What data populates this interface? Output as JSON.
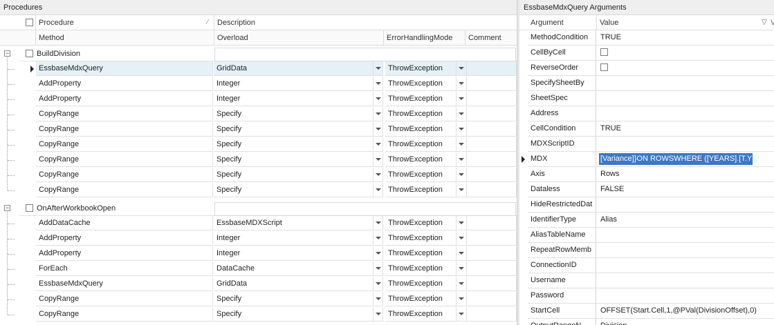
{
  "procedures": {
    "title": "Procedures",
    "header1": {
      "procedure": "Procedure",
      "description": "Description"
    },
    "header2": {
      "method": "Method",
      "overload": "Overload",
      "error_mode": "ErrorHandlingMode",
      "comment": "Comment"
    },
    "groups": [
      {
        "name": "BuildDivision",
        "rows": [
          {
            "method": "EssbaseMdxQuery",
            "overload": "GridData",
            "error_mode": "ThrowException",
            "selected": true
          },
          {
            "method": "AddProperty",
            "overload": "Integer",
            "error_mode": "ThrowException"
          },
          {
            "method": "AddProperty",
            "overload": "Integer",
            "error_mode": "ThrowException"
          },
          {
            "method": "CopyRange",
            "overload": "Specify",
            "error_mode": "ThrowException"
          },
          {
            "method": "CopyRange",
            "overload": "Specify",
            "error_mode": "ThrowException"
          },
          {
            "method": "CopyRange",
            "overload": "Specify",
            "error_mode": "ThrowException"
          },
          {
            "method": "CopyRange",
            "overload": "Specify",
            "error_mode": "ThrowException"
          },
          {
            "method": "CopyRange",
            "overload": "Specify",
            "error_mode": "ThrowException"
          },
          {
            "method": "CopyRange",
            "overload": "Specify",
            "error_mode": "ThrowException"
          }
        ]
      },
      {
        "name": "OnAfterWorkbookOpen",
        "rows": [
          {
            "method": "AddDataCache",
            "overload": "EssbaseMDXScript",
            "error_mode": "ThrowException"
          },
          {
            "method": "AddProperty",
            "overload": "Integer",
            "error_mode": "ThrowException"
          },
          {
            "method": "AddProperty",
            "overload": "Integer",
            "error_mode": "ThrowException"
          },
          {
            "method": "ForEach",
            "overload": "DataCache",
            "error_mode": "ThrowException"
          },
          {
            "method": "EssbaseMdxQuery",
            "overload": "GridData",
            "error_mode": "ThrowException"
          },
          {
            "method": "CopyRange",
            "overload": "Specify",
            "error_mode": "ThrowException"
          },
          {
            "method": "CopyRange",
            "overload": "Specify",
            "error_mode": "ThrowException"
          }
        ]
      }
    ]
  },
  "arguments": {
    "title": "EssbaseMdxQuery Arguments",
    "header": {
      "argument": "Argument",
      "value": "Value",
      "trailing": "V"
    },
    "rows": [
      {
        "name": "MethodCondition",
        "value": "TRUE"
      },
      {
        "name": "CellByCell",
        "value": "",
        "checkbox": true
      },
      {
        "name": "ReverseOrder",
        "value": "",
        "checkbox": true
      },
      {
        "name": "SpecifySheetBy",
        "value": ""
      },
      {
        "name": "SheetSpec",
        "value": ""
      },
      {
        "name": "Address",
        "value": ""
      },
      {
        "name": "CellCondition",
        "value": "TRUE"
      },
      {
        "name": "MDXScriptID",
        "value": ""
      },
      {
        "name": "MDX",
        "value": "[Variance]}ON ROWSWHERE ([YEARS].[T.YEARS])",
        "editing": true,
        "current": true
      },
      {
        "name": "Axis",
        "value": "Rows"
      },
      {
        "name": "Dataless",
        "value": "FALSE"
      },
      {
        "name": "HideRestrictedDat",
        "value": ""
      },
      {
        "name": "IdentifierType",
        "value": "Alias"
      },
      {
        "name": "AliasTableName",
        "value": ""
      },
      {
        "name": "RepeatRowMemb",
        "value": ""
      },
      {
        "name": "ConnectionID",
        "value": ""
      },
      {
        "name": "Username",
        "value": ""
      },
      {
        "name": "Password",
        "value": ""
      },
      {
        "name": "StartCell",
        "value": "OFFSET(Start.Cell,1,@PVal(DivisionOffset),0)"
      },
      {
        "name": "OutputRangeN",
        "value": "Division"
      }
    ]
  }
}
